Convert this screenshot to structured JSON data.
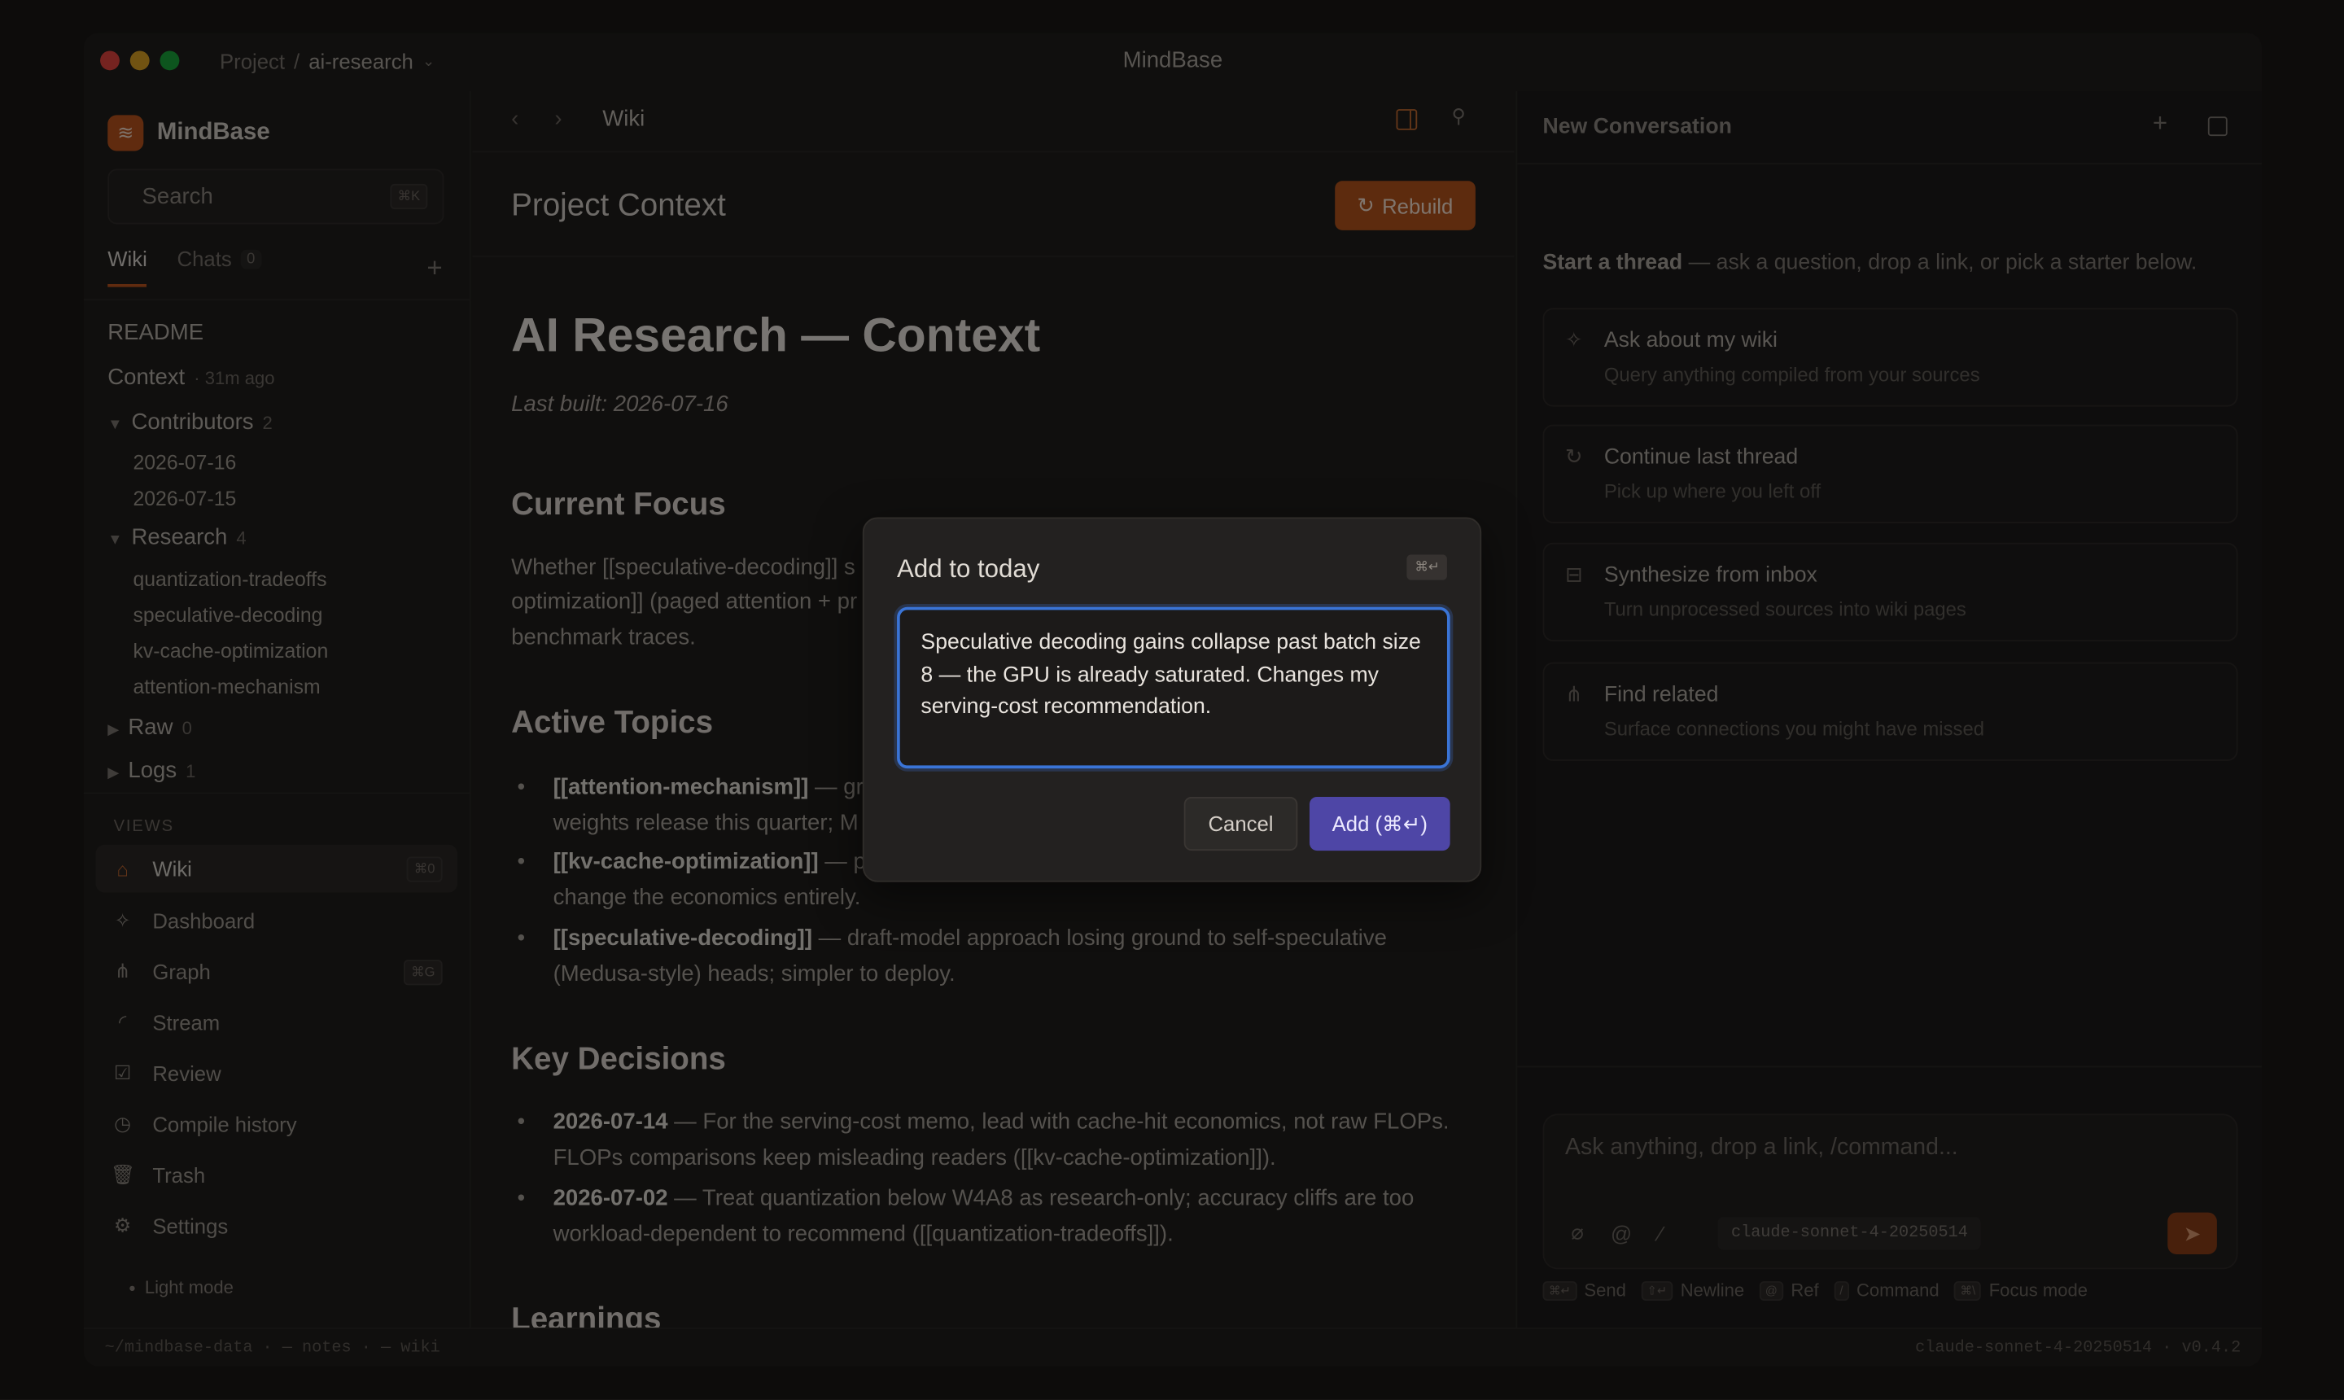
{
  "window": {
    "title": "MindBase",
    "project_label": "Project",
    "project_separator": "/",
    "project_name": "ai-research",
    "traffic_lights": [
      "#e0443e",
      "#d8a024",
      "#1aa33a"
    ]
  },
  "sidebar": {
    "brand": "MindBase",
    "search_placeholder": "Search",
    "search_shortcut": "⌘K",
    "tabs": [
      {
        "label": "Wiki"
      },
      {
        "label": "Chats",
        "count": "0"
      }
    ],
    "add_label": "+",
    "tree": {
      "readme": "README",
      "context": {
        "label": "Context",
        "meta": "· 31m ago"
      },
      "contributors": {
        "label": "Contributors",
        "count": "2",
        "children": [
          "2026-07-16",
          "2026-07-15"
        ]
      },
      "research": {
        "label": "Research",
        "count": "4",
        "children": [
          "quantization-tradeoffs",
          "speculative-decoding",
          "kv-cache-optimization",
          "attention-mechanism"
        ]
      },
      "raw": {
        "label": "Raw",
        "count": "0"
      },
      "logs": {
        "label": "Logs",
        "count": "1"
      }
    },
    "views_heading": "VIEWS",
    "nav": [
      {
        "label": "Wiki",
        "icon": "home-icon",
        "shortcut": "⌘0"
      },
      {
        "label": "Dashboard",
        "icon": "sparkles-icon"
      },
      {
        "label": "Graph",
        "icon": "graph-icon",
        "shortcut": "⌘G"
      },
      {
        "label": "Stream",
        "icon": "rss-icon"
      },
      {
        "label": "Review",
        "icon": "checkbox-icon"
      },
      {
        "label": "Compile history",
        "icon": "history-icon"
      },
      {
        "label": "Trash",
        "icon": "trash-icon"
      },
      {
        "label": "Settings",
        "icon": "gear-icon"
      }
    ],
    "light_mode": "Light mode"
  },
  "main": {
    "breadcrumb": "Wiki",
    "page_title": "Project Context",
    "rebuild_label": "Rebuild",
    "doc": {
      "h1": "AI Research — Context",
      "built": "Last built: 2026-07-16",
      "current_focus_heading": "Current Focus",
      "current_focus_lines": [
        "Whether [[speculative-decoding]] s",
        "optimization]] (paged attention + pr",
        "benchmark traces."
      ],
      "active_topics_heading": "Active Topics",
      "active_topics": [
        {
          "bold": "[[attention-mechanism]]",
          "line1": " — gro",
          "line2": "weights release this quarter; M"
        },
        {
          "bold": "[[kv-cache-optimization]]",
          "line1": " — p",
          "line2": "change the economics entirely."
        },
        {
          "bold": "[[speculative-decoding]]",
          "line1": " — draft-model approach losing ground to self-speculative",
          "line2": "(Medusa-style) heads; simpler to deploy."
        }
      ],
      "key_decisions_heading": "Key Decisions",
      "key_decisions": [
        {
          "bold": "2026-07-14",
          "line1": " — For the serving-cost memo, lead with cache-hit economics, not raw FLOPs.",
          "line2": "FLOPs comparisons keep misleading readers ([[kv-cache-optimization]])."
        },
        {
          "bold": "2026-07-02",
          "line1": " — Treat quantization below W4A8 as research-only; accuracy cliffs are too",
          "line2": "workload-dependent to recommend ([[quantization-tradeoffs]])."
        }
      ],
      "learnings_heading": "Learnings"
    }
  },
  "chat": {
    "title": "New Conversation",
    "intro_bold": "Start a thread",
    "intro_rest": " — ask a question, drop a link, or pick a starter below.",
    "starters": [
      {
        "title": "Ask about my wiki",
        "subtitle": "Query anything compiled from your sources",
        "icon": "sparkles-icon"
      },
      {
        "title": "Continue last thread",
        "subtitle": "Pick up where you left off",
        "icon": "refresh-icon"
      },
      {
        "title": "Synthesize from inbox",
        "subtitle": "Turn unprocessed sources into wiki pages",
        "icon": "inbox-icon"
      },
      {
        "title": "Find related",
        "subtitle": "Surface connections you might have missed",
        "icon": "network-icon"
      }
    ],
    "composer_placeholder": "Ask anything, drop a link, /command...",
    "model": "claude-sonnet-4-20250514",
    "hints": [
      {
        "key": "⌘↵",
        "label": "Send"
      },
      {
        "key": "⇧↵",
        "label": "Newline"
      },
      {
        "key": "@",
        "label": "Ref"
      },
      {
        "key": "/",
        "label": "Command"
      },
      {
        "key": "⌘\\",
        "label": "Focus mode"
      }
    ]
  },
  "statusbar": {
    "left": "~/mindbase-data  ·  — notes  ·  — wiki",
    "right": "claude-sonnet-4-20250514  ·  v0.4.2"
  },
  "modal": {
    "title": "Add to today",
    "shortcut": "⌘↵",
    "text": "Speculative decoding gains collapse past batch size 8 — the GPU is already saturated. Changes my serving-cost recommendation.",
    "cancel_label": "Cancel",
    "add_label": "Add (⌘↵)"
  }
}
